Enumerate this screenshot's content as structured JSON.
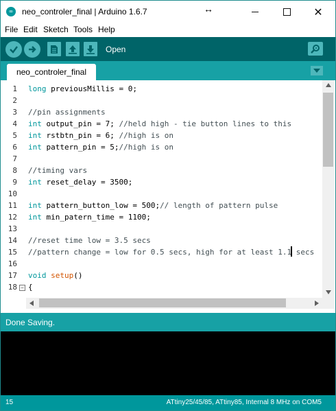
{
  "window": {
    "title": "neo_controler_final | Arduino 1.6.7",
    "app_icon_glyph": "∞",
    "resize_glyph": "↔",
    "close_glyph": "✕"
  },
  "menu": [
    "File",
    "Edit",
    "Sketch",
    "Tools",
    "Help"
  ],
  "toolbar": {
    "hover_label": "Open",
    "buttons": [
      "verify-icon",
      "upload-icon",
      "new-icon",
      "open-icon",
      "save-icon"
    ],
    "serial_monitor_icon": "magnifier-icon"
  },
  "tabs": [
    {
      "label": "neo_controler_final"
    }
  ],
  "editor": {
    "line_numbers": [
      "1",
      "2",
      "3",
      "4",
      "5",
      "6",
      "7",
      "8",
      "9",
      "10",
      "11",
      "12",
      "13",
      "14",
      "15",
      "16",
      "17",
      "18"
    ],
    "fold_marker": "−"
  },
  "status": {
    "message": "Done Saving."
  },
  "footer": {
    "line": "15",
    "board": "ATtiny25/45/85, ATtiny85, Internal 8 MHz on COM5"
  },
  "colors": {
    "toolbar": "#006468",
    "tabbar": "#17a1a5",
    "button": "#4db7bb",
    "keyword": "#00979c",
    "function": "#d35400",
    "footer": "#00979c"
  }
}
